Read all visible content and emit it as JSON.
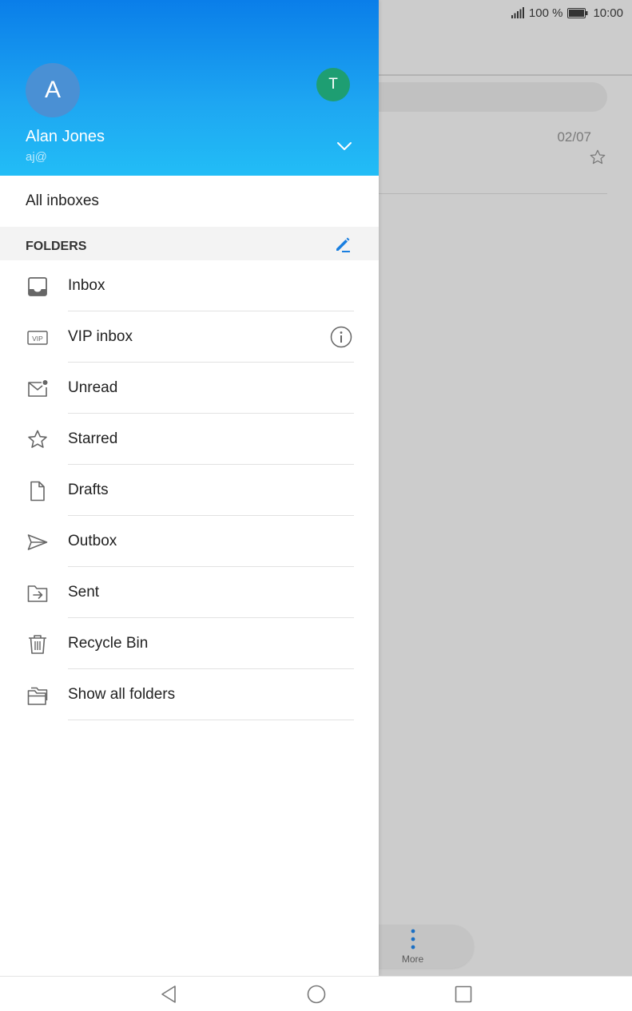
{
  "status_bar": {
    "battery": "100 %",
    "time": "10:00"
  },
  "background": {
    "email_date": "02/07",
    "more_label": "More"
  },
  "drawer": {
    "account": {
      "avatar_letter": "A",
      "name": "Alan Jones",
      "email": "aj@",
      "other_avatar_letter": "T"
    },
    "all_inboxes": "All inboxes",
    "folders_title": "FOLDERS",
    "folders": [
      {
        "label": "Inbox",
        "icon": "inbox-icon"
      },
      {
        "label": "VIP inbox",
        "icon": "vip-icon"
      },
      {
        "label": "Unread",
        "icon": "unread-mail-icon"
      },
      {
        "label": "Starred",
        "icon": "star-icon"
      },
      {
        "label": "Drafts",
        "icon": "draft-document-icon"
      },
      {
        "label": "Outbox",
        "icon": "send-icon"
      },
      {
        "label": "Sent",
        "icon": "sent-folder-icon"
      },
      {
        "label": "Recycle Bin",
        "icon": "trash-icon"
      },
      {
        "label": "Show all folders",
        "icon": "folders-icon"
      }
    ]
  },
  "colors": {
    "accent": "#1a7fe0",
    "header_top": "#0a7ee9",
    "header_bottom": "#22bdf6",
    "alt_avatar": "#1e9e72"
  }
}
